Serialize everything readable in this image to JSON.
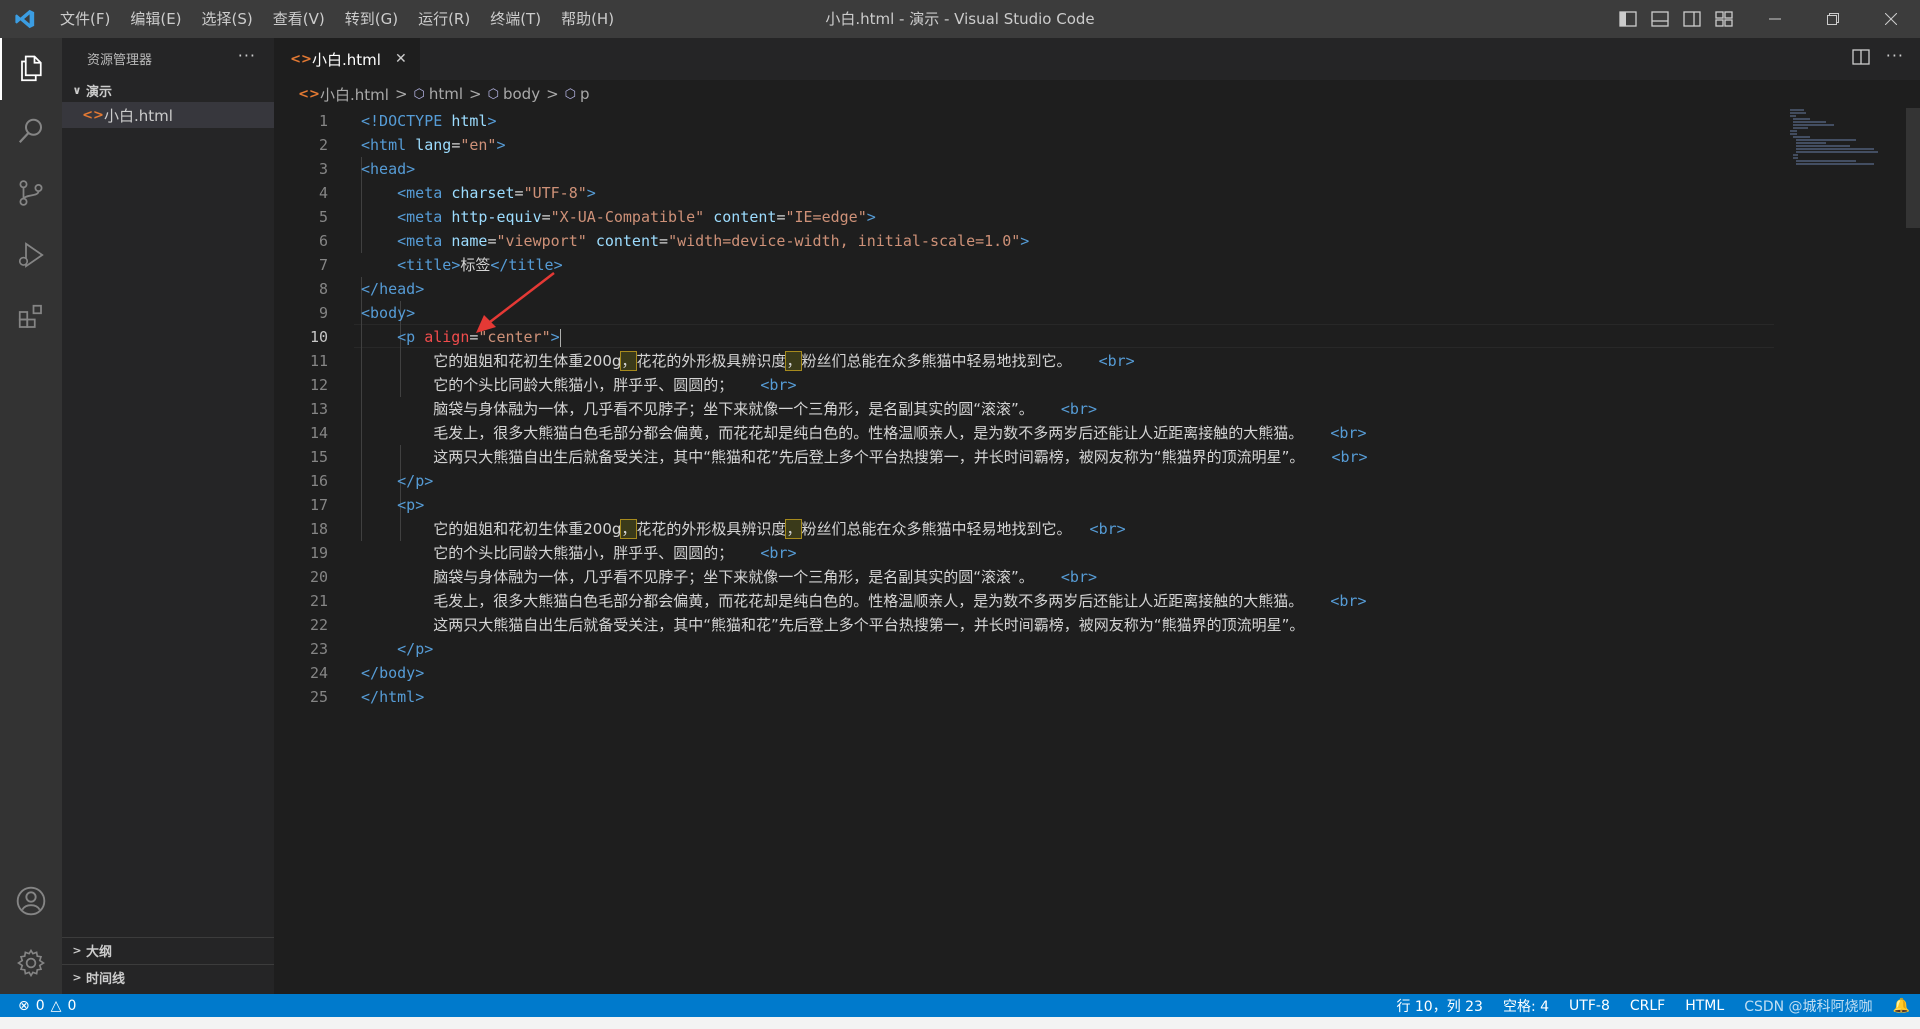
{
  "titlebar": {
    "menu": [
      "文件(F)",
      "编辑(E)",
      "选择(S)",
      "查看(V)",
      "转到(G)",
      "运行(R)",
      "终端(T)",
      "帮助(H)"
    ],
    "window_title": "小白.html - 演示 - Visual Studio Code"
  },
  "sidebar": {
    "header": "资源管理器",
    "more": "···",
    "folder": "演示",
    "file": "小白.html",
    "outline": "大纲",
    "timeline": "时间线"
  },
  "editor": {
    "tab_label": "小白.html",
    "breadcrumb": [
      "小白.html",
      "html",
      "body",
      "p"
    ],
    "current_line": 10
  },
  "code_text": {
    "doctype": "<!DOCTYPE",
    "html": "html",
    "lang": "lang",
    "lang_val": "\"en\"",
    "head": "head",
    "meta": "meta",
    "charset": "charset",
    "charset_val": "\"UTF-8\"",
    "http_equiv": "http-equiv",
    "http_equiv_val": "\"X-UA-Compatible\"",
    "content": "content",
    "content_ie": "\"IE=edge\"",
    "name": "name",
    "name_val": "\"viewport\"",
    "content_vp": "\"width=device-width, initial-scale=1.0\"",
    "title": "title",
    "title_text": "标签",
    "body": "body",
    "p": "p",
    "align": "align",
    "align_val": "\"center\"",
    "br": "br",
    "s1a": "它的姐姐和花初生体重200g",
    "s1b": "，",
    "s1c": "花花的外形极具辨识度",
    "s1d": "，",
    "s1e": "粉丝们总能在众多熊猫中轻易地找到它。",
    "s2": "它的个头比同龄大熊猫小，胖乎乎、圆圆的；",
    "s3": "脑袋与身体融为一体，几乎看不见脖子；坐下来就像一个三角形，是名副其实的圆“滚滚”。",
    "s4": "毛发上，很多大熊猫白色毛部分都会偏黄，而花花却是纯白色的。性格温顺亲人，是为数不多两岁后还能让人近距离接触的大熊猫。",
    "s5": "这两只大熊猫自出生后就备受关注，其中“熊猫和花”先后登上多个平台热搜第一，并长时间霸榜，被网友称为“熊猫界的顶流明星”。"
  },
  "status": {
    "errors": "0",
    "warnings": "0",
    "position": "行 10，列 23",
    "spaces": "空格: 4",
    "encoding": "UTF-8",
    "eol": "CRLF",
    "language": "HTML",
    "watermark": "CSDN @城科阿烧咖"
  },
  "colors": {
    "accent": "#007acc",
    "tag": "#569cd6",
    "attribute": "#9cdcfe",
    "string": "#ce9178",
    "annotation_arrow": "#e53935"
  },
  "icons": [
    "vscode-logo-icon",
    "explorer-icon",
    "search-icon",
    "source-control-icon",
    "run-debug-icon",
    "extensions-icon",
    "account-icon",
    "settings-gear-icon",
    "html-file-icon",
    "close-icon",
    "split-editor-icon",
    "error-icon",
    "warning-icon",
    "bell-icon"
  ]
}
